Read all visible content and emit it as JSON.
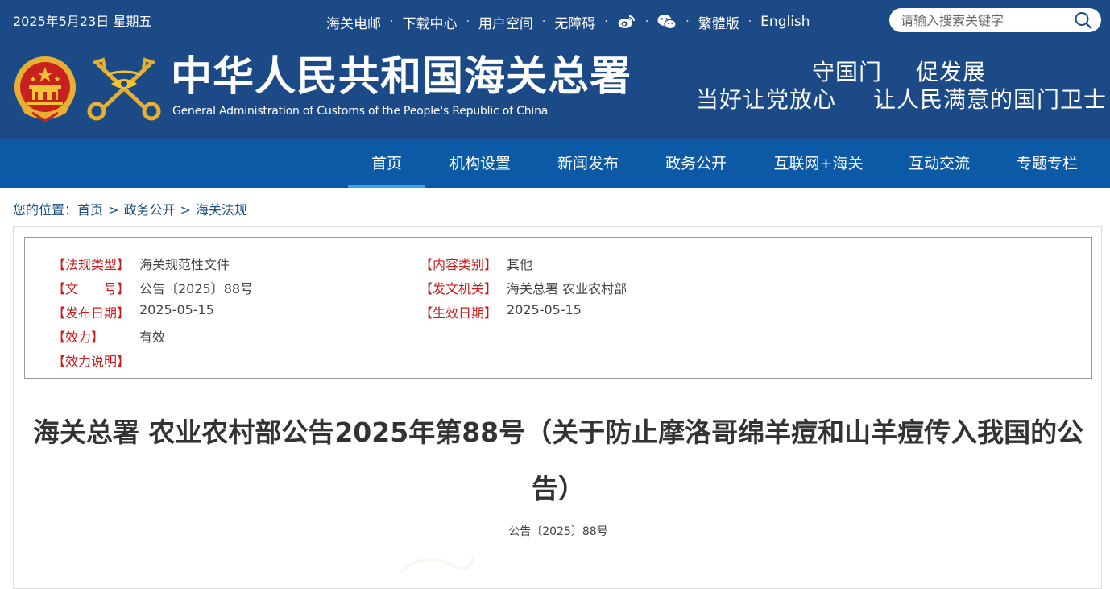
{
  "header": {
    "date": "2025年5月23日 星期五",
    "links": {
      "mail": "海关电邮",
      "downloads": "下载中心",
      "user_space": "用户空间",
      "accessibility": "无障碍",
      "traditional": "繁體版",
      "english": "English"
    },
    "separator": "·",
    "search_placeholder": "请输入搜索关键字",
    "title_cn": "中华人民共和国海关总署",
    "title_en": "General Administration of Customs of the People's Republic of China",
    "slogan_line1": [
      "守国门",
      "促发展"
    ],
    "slogan_line2": [
      "当好让党放心",
      "让人民满意的国门卫士"
    ],
    "colors": {
      "header_bg": "#1c4a87",
      "nav_bg": "#0c5aa6",
      "active_underline": "#3aa4ef"
    }
  },
  "nav": {
    "items": [
      "首页",
      "机构设置",
      "新闻发布",
      "政务公开",
      "互联网+海关",
      "互动交流",
      "专题专栏"
    ],
    "active": "首页"
  },
  "breadcrumb": {
    "prefix": "您的位置：",
    "items": [
      "首页",
      "政务公开",
      "海关法规"
    ],
    "separator": ">"
  },
  "meta": {
    "left": [
      {
        "label": "【法规类型】",
        "value": "海关规范性文件"
      },
      {
        "label": "【文　　号】",
        "value": "公告〔2025〕88号"
      },
      {
        "label": "【发布日期】",
        "value": "2025-05-15"
      },
      {
        "label": "【效力】",
        "value": "有效"
      },
      {
        "label": "【效力说明】",
        "value": ""
      }
    ],
    "right": [
      {
        "label": "【内容类别】",
        "value": "其他"
      },
      {
        "label": "【发文机关】",
        "value": "海关总署 农业农村部"
      },
      {
        "label": "【生效日期】",
        "value": "2025-05-15"
      }
    ],
    "label_color": "#cc1b1b"
  },
  "document": {
    "title": "海关总署 农业农村部公告2025年第88号（关于防止摩洛哥绵羊痘和山羊痘传入我国的公告）",
    "number": "公告〔2025〕88号"
  }
}
